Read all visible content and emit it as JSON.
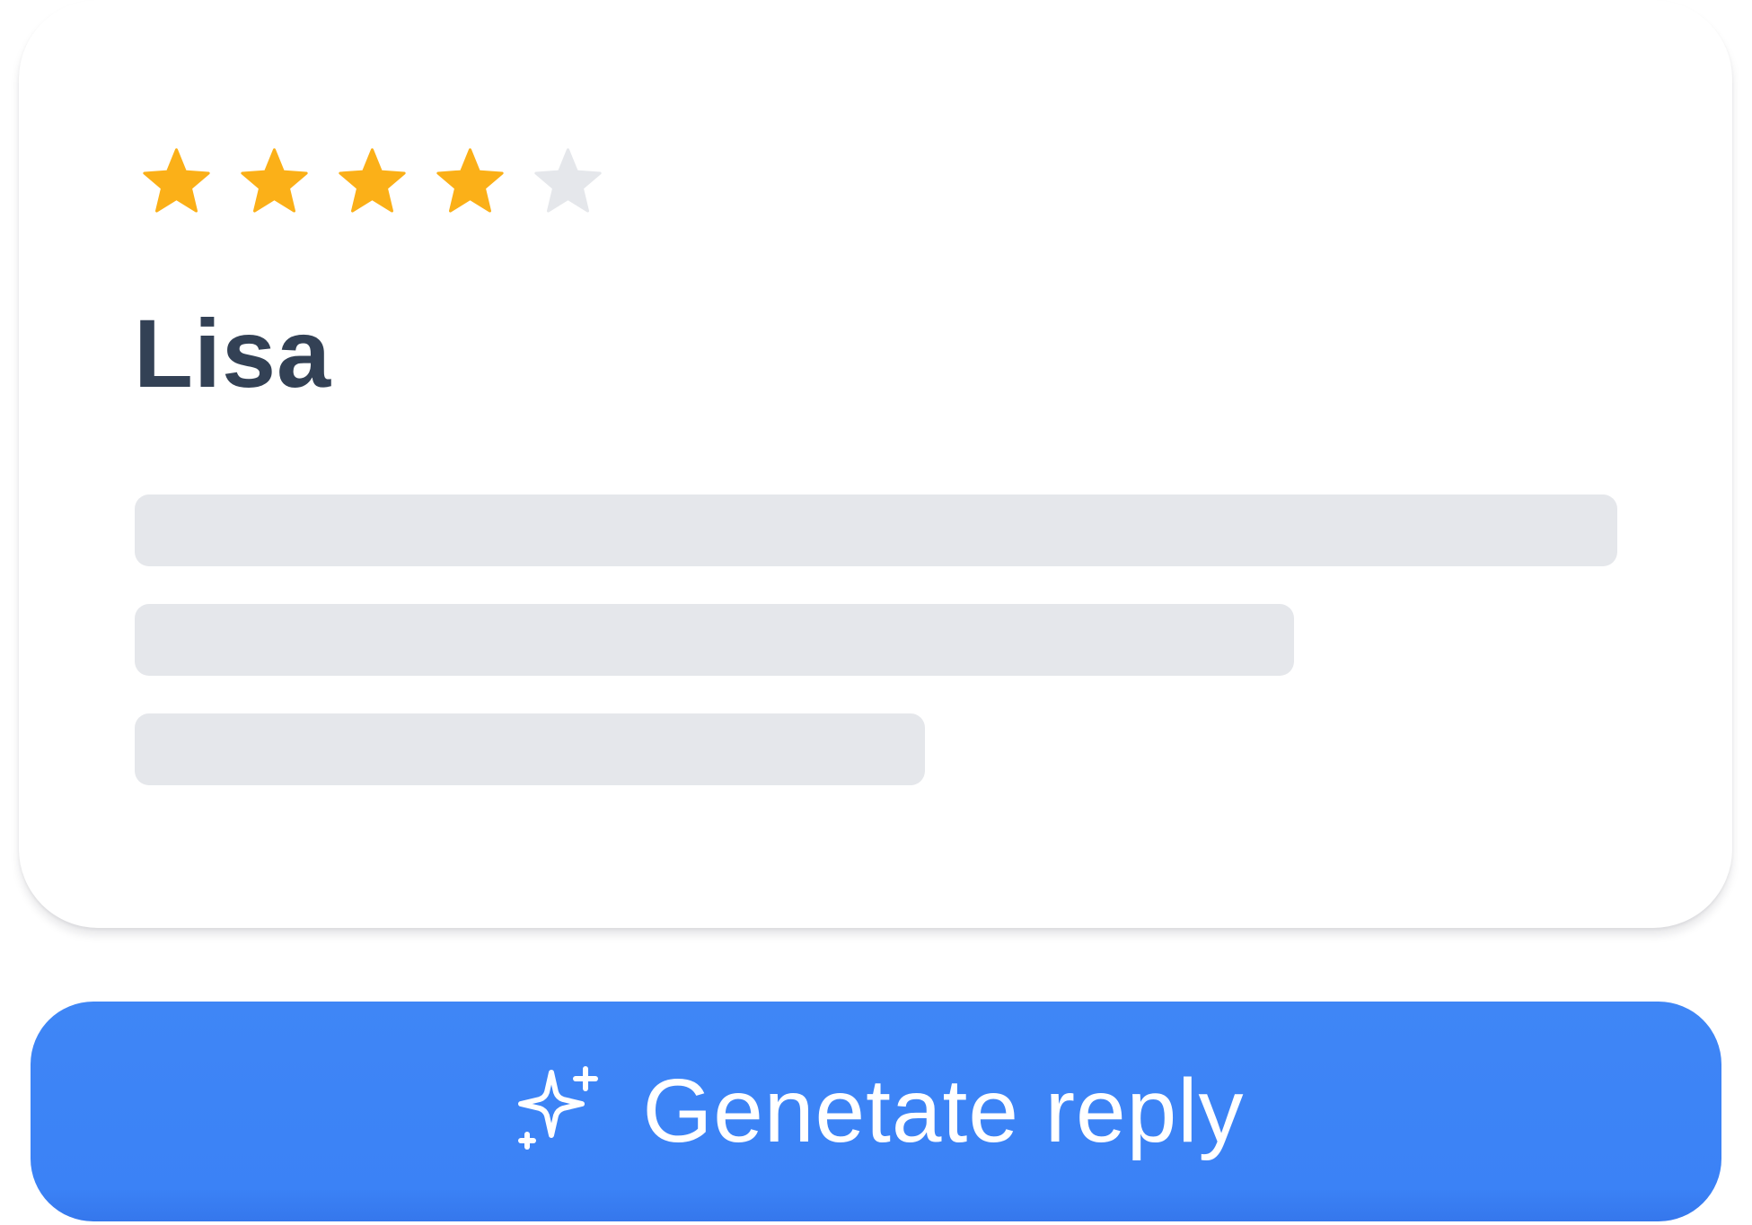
{
  "review": {
    "rating": 4,
    "max_rating": 5,
    "reviewer_name": "Lisa",
    "text_lines_placeholder_count": 3,
    "colors": {
      "star_filled": "#fbb018",
      "star_empty": "#e5e7eb",
      "name": "#334155",
      "skeleton": "#e5e7eb"
    }
  },
  "action": {
    "button_label": "Genetate reply",
    "icon": "sparkle-icon",
    "color": "#3b82f6"
  }
}
